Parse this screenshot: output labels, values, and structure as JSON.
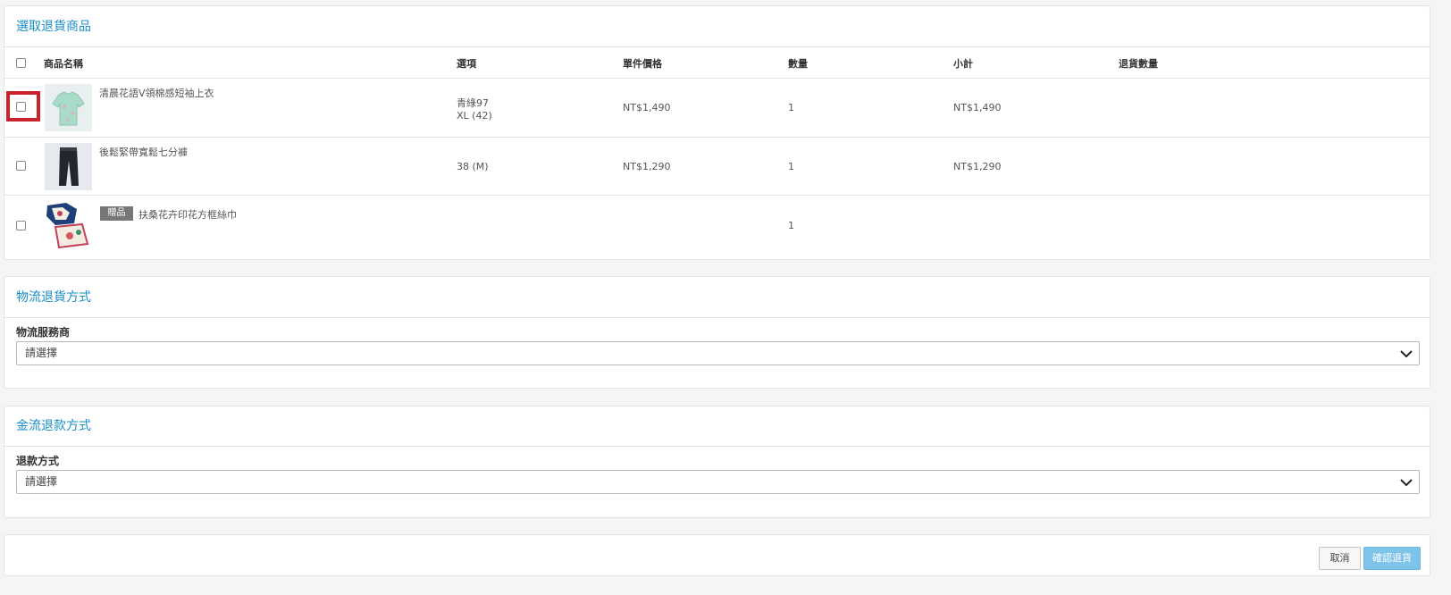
{
  "returns": {
    "title": "選取退貨商品",
    "headers": {
      "name": "商品名稱",
      "option": "選項",
      "unit_price": "單件價格",
      "quantity": "數量",
      "subtotal": "小計",
      "return_qty": "退貨數量"
    },
    "items": [
      {
        "name": "清晨花語V領棉感短袖上衣",
        "option_1": "青綠97",
        "option_2": "XL (42)",
        "price": "NT$1,490",
        "qty": "1",
        "subtotal": "NT$1,490",
        "image": "mint-blouse"
      },
      {
        "name": "後鬆緊帶寬鬆七分褲",
        "option_1": "38 (M)",
        "price": "NT$1,290",
        "qty": "1",
        "subtotal": "NT$1,290",
        "image": "dark-pants"
      },
      {
        "name": "扶桑花卉印花方框絲巾",
        "badge": "贈品",
        "qty": "1",
        "image": "silk-scarf"
      }
    ]
  },
  "logistics": {
    "title": "物流退貨方式",
    "label": "物流服務商",
    "selected": "請選擇"
  },
  "refund": {
    "title": "金流退款方式",
    "label": "退款方式",
    "selected": "請選擇"
  },
  "actions": {
    "cancel": "取消",
    "confirm": "確認退貨"
  },
  "colors": {
    "accent": "#1a8ec8",
    "highlight": "#c8232c",
    "confirm": "#7ec3ea"
  }
}
